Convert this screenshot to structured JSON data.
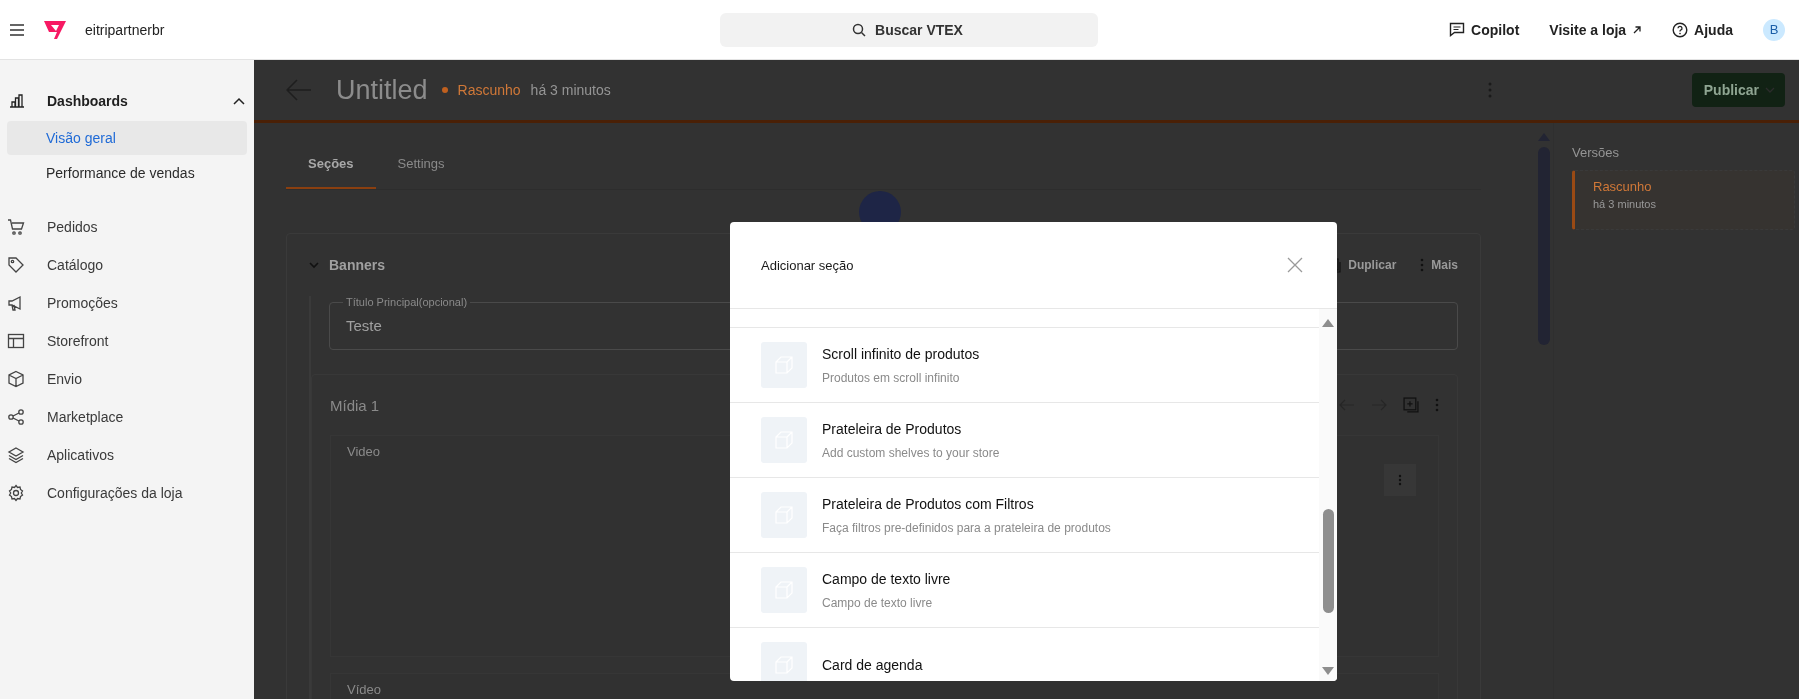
{
  "topbar": {
    "brand": "eitripartnerbr",
    "search": {
      "placeholder": "Buscar VTEX"
    },
    "actions": [
      {
        "label": "Copilot",
        "kind": "chat"
      },
      {
        "label": "Visite a loja",
        "kind": "external"
      },
      {
        "label": "Ajuda",
        "kind": "help"
      }
    ],
    "avatar": "B"
  },
  "sidebar": {
    "groups": [
      {
        "label": "Dashboards",
        "expanded": true,
        "children": [
          {
            "label": "Visão geral",
            "selected": true
          },
          {
            "label": "Performance de vendas",
            "selected": false
          }
        ]
      }
    ],
    "items": [
      {
        "label": "Pedidos",
        "kind": "cart"
      },
      {
        "label": "Catálogo",
        "kind": "tag"
      },
      {
        "label": "Promoções",
        "kind": "megaphone"
      },
      {
        "label": "Storefront",
        "kind": "layout"
      },
      {
        "label": "Envio",
        "kind": "box"
      },
      {
        "label": "Marketplace",
        "kind": "share"
      },
      {
        "label": "Aplicativos",
        "kind": "layers"
      },
      {
        "label": "Configurações da loja",
        "kind": "gear"
      }
    ]
  },
  "page": {
    "title": "Untitled",
    "status": "Rascunho",
    "time": "há 3 minutos",
    "publish": "Publicar",
    "tabs": [
      {
        "label": "Seções",
        "selected": true
      },
      {
        "label": "Settings",
        "selected": false
      }
    ],
    "section": {
      "title": "Banners",
      "expanded": true,
      "actions": [
        {
          "label": "Duplicar",
          "kind": "duplicate"
        },
        {
          "label": "Mais",
          "kind": "more"
        }
      ],
      "field": {
        "label": "Título Principal(opcional)",
        "value": "Teste"
      },
      "media": {
        "title": "Mídia 1",
        "blocks": [
          "Video",
          "Vídeo"
        ]
      }
    }
  },
  "versions": {
    "title": "Versões",
    "items": [
      {
        "name": "Rascunho",
        "time": "há 3 minutos",
        "selected": true
      }
    ]
  },
  "modal": {
    "title": "Adicionar seção",
    "items": [
      {
        "title": "Scroll infinito de produtos",
        "description": "Produtos em scroll infinito"
      },
      {
        "title": "Prateleira de Produtos",
        "description": "Add custom shelves to your store"
      },
      {
        "title": "Prateleira de Produtos com Filtros",
        "description": "Faça filtros pre-definidos para a prateleira de produtos"
      },
      {
        "title": "Campo de texto livre",
        "description": "Campo de texto livre"
      },
      {
        "title": "Card de agenda"
      }
    ]
  }
}
